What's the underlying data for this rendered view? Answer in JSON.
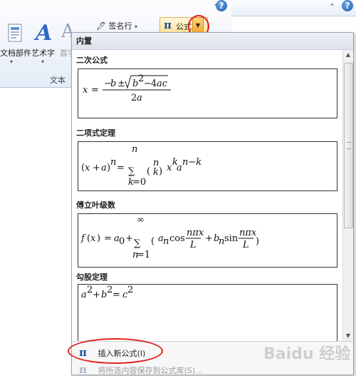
{
  "ribbon": {
    "document_parts_label": "文档部件",
    "wordart_label": "艺术字",
    "dropcap_label": "首字",
    "signature_line_label": "签名行",
    "group_label": "文本",
    "formula_label": "公式"
  },
  "dropdown": {
    "header": "内置",
    "sections": [
      {
        "title": "二次公式"
      },
      {
        "title": "二项式定理"
      },
      {
        "title": "傅立叶级数"
      },
      {
        "title": "勾股定理"
      }
    ],
    "insert_new": "插入新公式(I)",
    "save_selection": "将所选内容保存到公式库(S)..."
  },
  "colors": {
    "accent_circle": "#e0201b",
    "highlight": "#ffe49c"
  },
  "watermark": "Baidu 经验"
}
